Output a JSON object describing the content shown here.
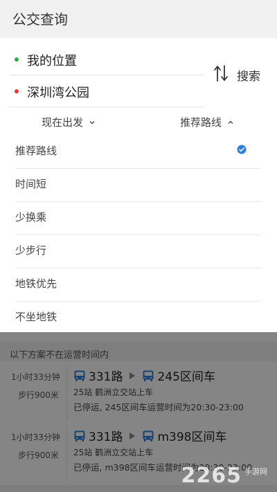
{
  "header": {
    "title": "公交查询"
  },
  "route": {
    "from": "我的位置",
    "to": "深圳湾公园",
    "search_label": "搜索",
    "colors": {
      "from_dot": "#2cae3a",
      "to_dot": "#e43b2e"
    }
  },
  "options": {
    "time_label": "现在出发",
    "strategy_label": "推荐路线"
  },
  "dropdown": {
    "items": [
      {
        "label": "推荐路线",
        "selected": true
      },
      {
        "label": "时间短"
      },
      {
        "label": "少换乘"
      },
      {
        "label": "少步行"
      },
      {
        "label": "地铁优先"
      },
      {
        "label": "不坐地铁"
      }
    ],
    "check_color": "#2f7fd8"
  },
  "results": {
    "notice": "以下方案不在运营时间内",
    "plans": [
      {
        "duration": "1小时33分钟",
        "walk": "步行900米",
        "line1": "331路",
        "line2": "245区间车",
        "stops": "25站  鹤洲立交站上车",
        "status": "已停运, 245区间车运营时间为20:30-23:00"
      },
      {
        "duration": "1小时33分钟",
        "walk": "步行900米",
        "line1": "331路",
        "line2": "m398区间车",
        "stops": "25站  鹤洲立交站上车",
        "status": "已停运, m398区间车运营时间为20:30-23:00"
      }
    ]
  },
  "watermark": {
    "main": "2265",
    "sub": "手游网"
  },
  "icons": {
    "swap": "swap-arrows-icon",
    "chevron_down": "chevron-down-icon",
    "chevron_up": "chevron-up-icon",
    "check": "check-circle-icon",
    "bus": "bus-icon"
  }
}
